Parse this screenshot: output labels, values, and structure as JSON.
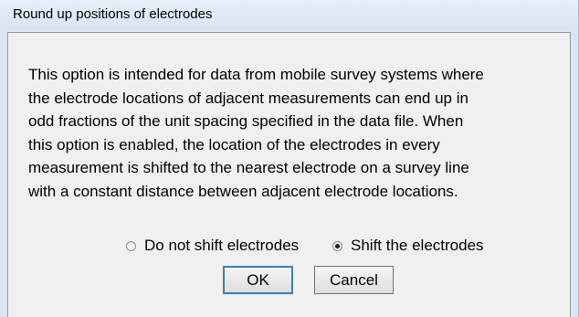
{
  "dialog": {
    "title": "Round up positions of electrodes",
    "description_lines": [
      "This option is intended for data from mobile survey systems where",
      "the electrode locations of adjacent measurements can end up in",
      "odd fractions of the unit spacing specified in the data file. When",
      "this option is enabled, the location of the electrodes in every",
      "measurement is shifted to the nearest electrode on a survey line",
      "with a constant distance between adjacent electrode locations."
    ],
    "options": [
      {
        "label": "Do not shift electrodes",
        "checked": false
      },
      {
        "label": "Shift the electrodes",
        "checked": true
      }
    ],
    "ok_label": "OK",
    "cancel_label": "Cancel"
  },
  "colors": {
    "title_bar": "#dbe7f4",
    "client_bg": "#f0f0f0",
    "default_button_border": "#3c7fb1"
  }
}
